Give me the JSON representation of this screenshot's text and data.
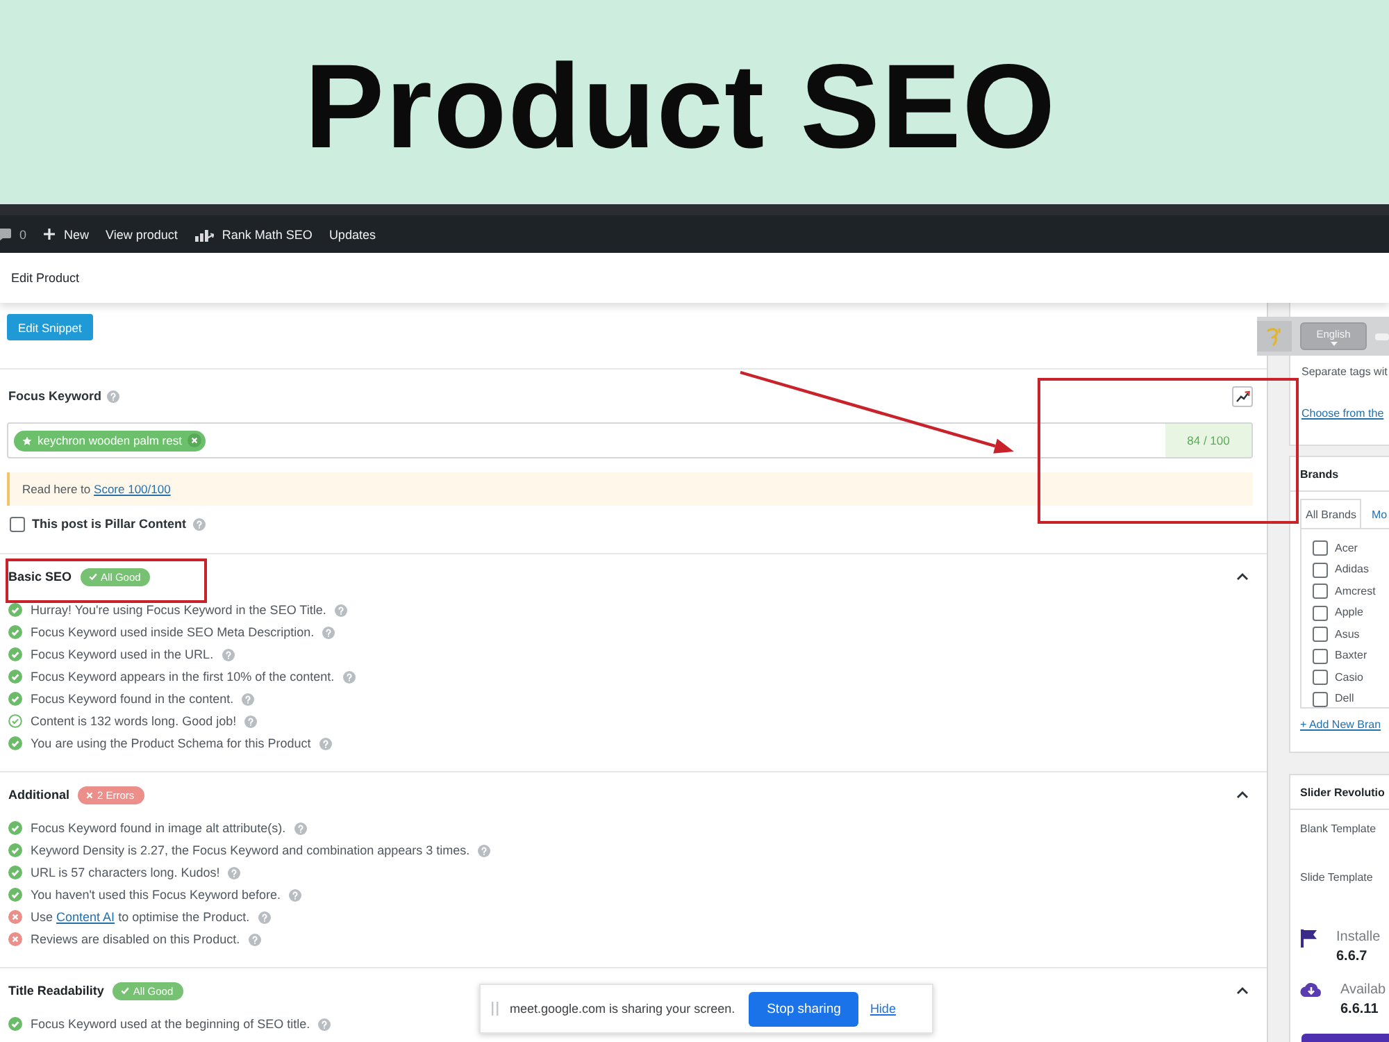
{
  "banner": {
    "title": "Product SEO"
  },
  "admin_bar": {
    "items": [
      {
        "kind": "comments",
        "label": "0"
      },
      {
        "kind": "new",
        "label": "New"
      },
      {
        "kind": "link",
        "label": "View product"
      },
      {
        "kind": "rank_math",
        "label": "Rank Math SEO"
      },
      {
        "kind": "link",
        "label": "Updates"
      }
    ]
  },
  "page_header": {
    "title": "Edit Product"
  },
  "seo_panel": {
    "edit_snippet_button": "Edit Snippet",
    "focus_keyword": {
      "label": "Focus Keyword",
      "keywords": [
        {
          "text": "keychron wooden palm rest",
          "primary": true
        }
      ],
      "score": "84 / 100"
    },
    "notice": {
      "text": "Read here to",
      "link": "Score 100/100"
    },
    "pillar_content": {
      "label": "This post is Pillar Content",
      "checked": false
    },
    "sections": [
      {
        "title": "Basic SEO",
        "badge": {
          "kind": "good",
          "text": "All Good"
        },
        "expanded": true,
        "checks": [
          {
            "kind": "pass",
            "text": "Hurray! You're using Focus Keyword in the SEO Title."
          },
          {
            "kind": "pass",
            "text": "Focus Keyword used inside SEO Meta Description."
          },
          {
            "kind": "pass",
            "text": "Focus Keyword used in the URL."
          },
          {
            "kind": "pass",
            "text": "Focus Keyword appears in the first 10% of the content."
          },
          {
            "kind": "pass",
            "text": "Focus Keyword found in the content."
          },
          {
            "kind": "outline",
            "text": "Content is 132 words long. Good job!"
          },
          {
            "kind": "pass",
            "text": "You are using the Product Schema for this Product"
          }
        ]
      },
      {
        "title": "Additional",
        "badge": {
          "kind": "errors",
          "text": "2 Errors"
        },
        "expanded": true,
        "checks": [
          {
            "kind": "pass",
            "text": "Focus Keyword found in image alt attribute(s)."
          },
          {
            "kind": "pass",
            "text": "Keyword Density is 2.27, the Focus Keyword and combination appears 3 times."
          },
          {
            "kind": "pass",
            "text": "URL is 57 characters long. Kudos!"
          },
          {
            "kind": "pass",
            "text": "You haven't used this Focus Keyword before."
          },
          {
            "kind": "fail",
            "text": "Use",
            "link": "Content AI",
            "text_after": "to optimise the Product."
          },
          {
            "kind": "fail",
            "text": "Reviews are disabled on this Product."
          }
        ]
      },
      {
        "title": "Title Readability",
        "badge": {
          "kind": "good",
          "text": "All Good"
        },
        "expanded": true,
        "checks": [
          {
            "kind": "pass",
            "text": "Focus Keyword used at the beginning of SEO title."
          }
        ]
      }
    ]
  },
  "sidebar": {
    "language_select": {
      "value": "English"
    },
    "tags": {
      "hint": "Separate tags wit",
      "link": "Choose from the"
    },
    "brands": {
      "title": "Brands",
      "tabs": [
        {
          "label": "All Brands",
          "selected": true
        },
        {
          "label": "Mo",
          "selected": false
        }
      ],
      "items": [
        {
          "label": "Acer",
          "checked": false
        },
        {
          "label": "Adidas",
          "checked": false
        },
        {
          "label": "Amcrest",
          "checked": false
        },
        {
          "label": "Apple",
          "checked": false
        },
        {
          "label": "Asus",
          "checked": false
        },
        {
          "label": "Baxter",
          "checked": false
        },
        {
          "label": "Casio",
          "checked": false
        },
        {
          "label": "Dell",
          "checked": false
        }
      ],
      "add_link": "+ Add New Bran"
    },
    "slider_revolution": {
      "title": "Slider Revolutio",
      "templates": [
        "Blank Template",
        "Slide Template"
      ],
      "versions": [
        {
          "kind": "installed",
          "label": "Installe",
          "number": "6.6.7"
        },
        {
          "kind": "available",
          "label": "Availab",
          "number": "6.6.11"
        }
      ]
    }
  },
  "screen_share_bar": {
    "message": "meet.google.com is sharing your screen.",
    "stop_button": "Stop sharing",
    "hide_link": "Hide"
  }
}
